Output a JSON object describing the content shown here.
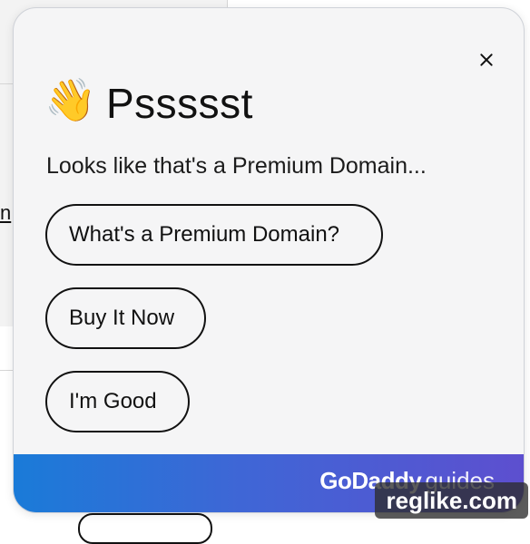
{
  "background": {
    "link_fragment": "n"
  },
  "widget": {
    "emoji": "👋",
    "title": "Pssssst",
    "message": "Looks like that's a Premium Domain...",
    "options": [
      {
        "label": "What's a Premium Domain?"
      },
      {
        "label": "Buy It Now"
      },
      {
        "label": "I'm Good"
      }
    ],
    "footer": {
      "brand_main": "GoDaddy",
      "brand_sub": "guides",
      "gradient_colors": [
        "#1a7bd8",
        "#5d4fcf"
      ]
    },
    "close_icon": "close-icon"
  },
  "watermark": {
    "text": "reglike.com"
  }
}
